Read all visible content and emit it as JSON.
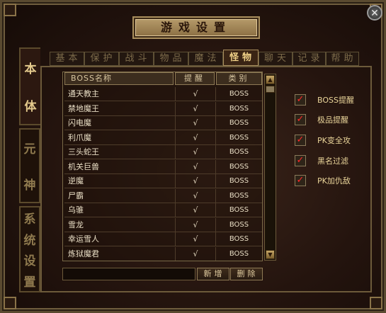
{
  "title": "游戏设置",
  "close_label": "✕",
  "side_tabs": [
    {
      "label": "本体",
      "active": true
    },
    {
      "label": "元神",
      "active": false
    },
    {
      "label": "系统设置",
      "active": false
    }
  ],
  "top_tabs": [
    {
      "label": "基本",
      "active": false
    },
    {
      "label": "保护",
      "active": false
    },
    {
      "label": "战斗",
      "active": false
    },
    {
      "label": "物品",
      "active": false
    },
    {
      "label": "魔法",
      "active": false
    },
    {
      "label": "怪物",
      "active": true
    },
    {
      "label": "聊天",
      "active": false
    },
    {
      "label": "记录",
      "active": false
    },
    {
      "label": "帮助",
      "active": false
    }
  ],
  "table": {
    "headers": {
      "name": "BOSS名称",
      "remind": "提醒",
      "type": "类别"
    },
    "rows": [
      {
        "name": "通天教主",
        "remind": "√",
        "type": "BOSS"
      },
      {
        "name": "禁地魔王",
        "remind": "√",
        "type": "BOSS"
      },
      {
        "name": "闪电魔",
        "remind": "√",
        "type": "BOSS"
      },
      {
        "name": "利爪魔",
        "remind": "√",
        "type": "BOSS"
      },
      {
        "name": "三头蛇王",
        "remind": "√",
        "type": "BOSS"
      },
      {
        "name": "机关巨兽",
        "remind": "√",
        "type": "BOSS"
      },
      {
        "name": "逆魔",
        "remind": "√",
        "type": "BOSS"
      },
      {
        "name": "尸霸",
        "remind": "√",
        "type": "BOSS"
      },
      {
        "name": "乌骓",
        "remind": "√",
        "type": "BOSS"
      },
      {
        "name": "雪龙",
        "remind": "√",
        "type": "BOSS"
      },
      {
        "name": "幸运雪人",
        "remind": "√",
        "type": "BOSS"
      },
      {
        "name": "炼狱魔君",
        "remind": "√",
        "type": "BOSS"
      }
    ]
  },
  "scrollbar": {
    "up_icon": "▲",
    "down_icon": "▼"
  },
  "add_input": {
    "value": ""
  },
  "buttons": {
    "add": "新增",
    "delete": "删除"
  },
  "options": [
    {
      "label": "BOSS提醒",
      "checked": true
    },
    {
      "label": "极品提醒",
      "checked": true
    },
    {
      "label": "PK变全攻",
      "checked": true
    },
    {
      "label": "黑名过滤",
      "checked": true
    },
    {
      "label": "PK加仇敌",
      "checked": true
    }
  ],
  "check_mark": "✓",
  "colors": {
    "accent": "#f0d188",
    "check": "#ff2a2a",
    "text": "#e8ddc4"
  }
}
